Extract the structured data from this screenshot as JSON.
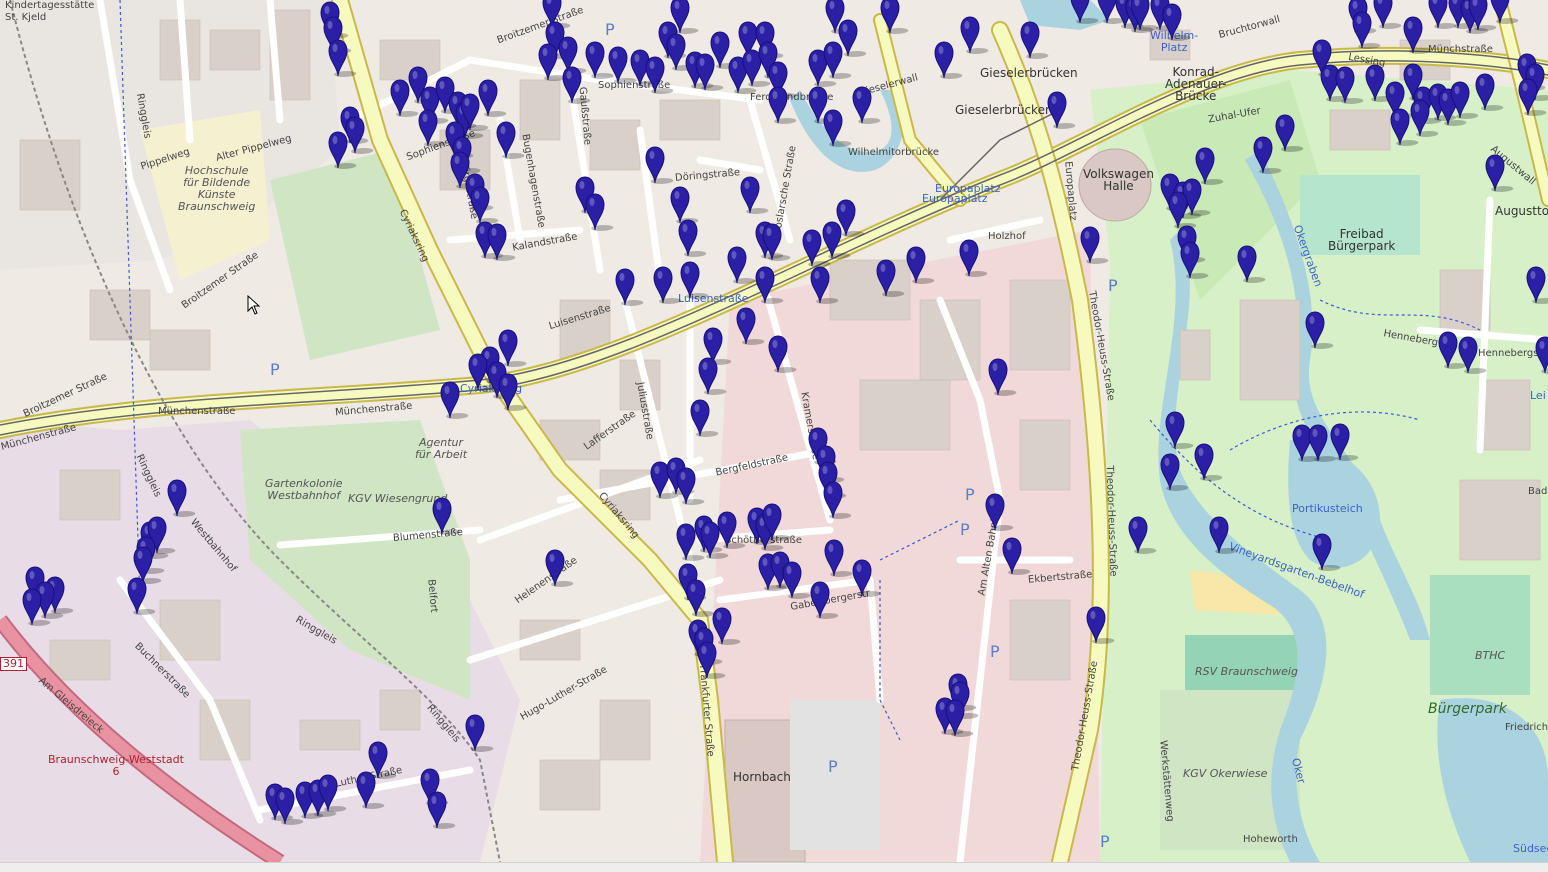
{
  "labels": {
    "kita": "Kindertagesstätte\nSt. Kjeld",
    "hochschule": "Hochschule\nfür Bildende\nKünste\nBraunschweig",
    "pippelweg": "Pippelweg",
    "alter_pippelweg": "Alter Pippelweg",
    "broitzemer1": "Broitzemer Straße",
    "broitzemer2": "Broitzemer Straße",
    "broitzemer3": "Broitzemer Straße",
    "sophienstr": "Sophienstraße",
    "sophienstr2": "Sophienstraße",
    "cyriaksring1": "Cyriaksring",
    "cyriaksring2": "Cyriaksring",
    "cyriaksring_bus": "Cyriaksring",
    "luisenstr": "Luisenstraße",
    "luisenstr_bus": "Luisenstraße",
    "munchenstr1": "Münchenstraße",
    "munchenstr2": "Münchenstraße",
    "munchenstr3": "Münchenstraße",
    "agentur": "Agentur\nfür Arbeit",
    "gartenkolonie": "Gartenkolonie\nWestbahnhof",
    "kgv_wiesengrund": "KGV Wiesengrund",
    "blumenstr": "Blumenstraße",
    "helenenstr": "Helenenstraße",
    "lafferstr": "Lafferstraße",
    "juliusstr": "Juliusstraße",
    "bergfeldstr": "Bergfeldstraße",
    "doringstr": "Döringstraße",
    "kalandstr": "Kalandstraße",
    "holzhof": "Holzhof",
    "europaplatz": "Europaplatz",
    "europaplatz_bus": "Europaplatz",
    "europaplatz_road": "Europaplatz",
    "theodor1": "Theodor-Heuss-Straße",
    "theodor2": "Theodor-Heuss-Straße",
    "theodor3": "Theodor-Heuss-Straße",
    "volkswagen": "Volkswagen\nHalle",
    "gieselerbrucken": "Gieselerbrücken",
    "gieselerbrucken2": "Gieselerbrücken",
    "gieselerwall": "Gieselerwall",
    "wilhelmitorbrucke": "Wilhelmitorbrücke",
    "konrad": "Konrad-\nAdenauer-\nBrücke",
    "bruchtorwall": "Bruchtorwall",
    "wilhelmplatz": "Wilhelm-\nPlatz",
    "munchstrasse": "Münchstraße",
    "zuhalsufer": "Zuhal-Ufer",
    "freibad": "Freibad\nBürgerpark",
    "okergraben": "Okergraben",
    "henneberg": "Henneberg",
    "henneberg2": "Hennebergstr",
    "portikusteich": "Portikusteich",
    "vineyards": "Vineyardsgarten-Bebelhof",
    "rsv": "RSV Braunschweig",
    "bthc": "BTHC",
    "burgerpark": "Bürgerpark",
    "kgv_okerwiese": "KGV Okerwiese",
    "hoheworth": "Hoheworth",
    "hornbach": "Hornbach",
    "frankfurter": "Frankfurter Straße",
    "am_alten_bahnhof": "Am Alten Bahnhof",
    "ekbertstr": "Ekbertstraße",
    "hugo1": "Hugo-Luther-Straße",
    "hugo2": "Hugo-Luther-Straße",
    "buchnerstr": "Buchnerstraße",
    "westbahnhof": "Westbahnhof",
    "ringgleis1": "Ringgleis",
    "ringgleis2": "Ringgleis",
    "ringgleis3": "Ringgleis",
    "ringgleis4": "Ringgleis",
    "weststadt": "Braunschweig-Weststadt\n6",
    "amsterdam": "Am Gleisdreieck",
    "schottelstr": "Schöttlerstraße",
    "lessing": "Lessing",
    "augusttor": "Augusttor",
    "augustwall": "Augustwall",
    "kramerstr": "Kramerstraße",
    "gabelsbergerstr": "Gabelsbergerstr",
    "friedrich": "Friedrich-",
    "werkstattenweg": "Werkstättenweg",
    "okerufer": "Oker",
    "sudsee": "Südsee",
    "belfort": "Belfort",
    "bad": "Bad",
    "lei": "Lei",
    "route91": "391",
    "cyriaksring_upper": "Cyriaksring",
    "ferdinandbrucke": "Ferdinandbrücke",
    "gauss": "Gaußstraße",
    "bugenhagen": "Bugenhagenstraße",
    "goslarsche": "Goslarsche Straße",
    "virgilst": "Virgilstraße"
  },
  "markers": {
    "count": 168,
    "color": "#2b1fa6"
  },
  "icons": {
    "cursor": "mouse-pointer-icon",
    "parking": "P"
  }
}
